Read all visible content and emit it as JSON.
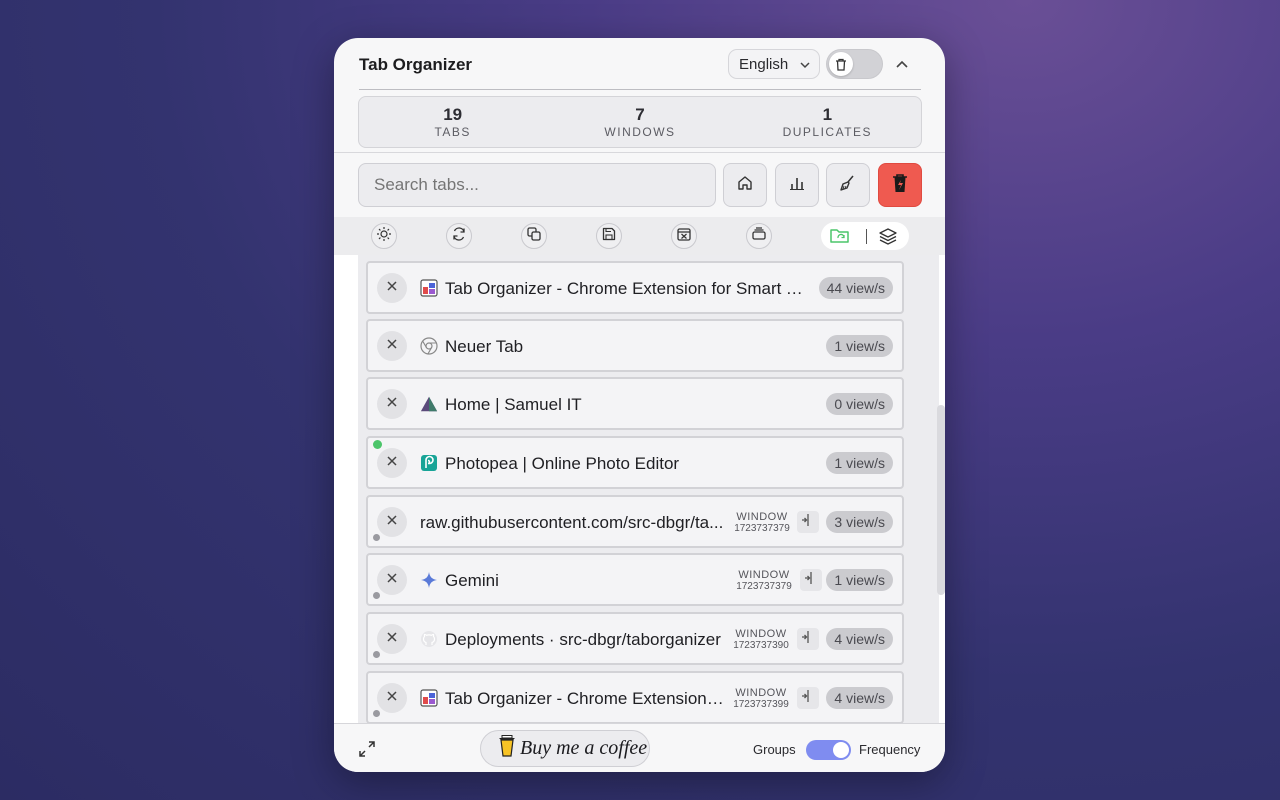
{
  "header": {
    "title": "Tab Organizer",
    "language": "English",
    "icons": [
      "chevron-down-icon",
      "trash-icon",
      "chevron-up-icon"
    ]
  },
  "stats": [
    {
      "value": "19",
      "label": "TABS"
    },
    {
      "value": "7",
      "label": "WINDOWS"
    },
    {
      "value": "1",
      "label": "DUPLICATES"
    }
  ],
  "search": {
    "placeholder": "Search tabs..."
  },
  "toolbar": {
    "buttons": [
      "home-icon",
      "bar-chart-icon",
      "broom-icon",
      "trash-lightning-icon"
    ],
    "danger_color": "#ef5a50"
  },
  "iconbar": {
    "buttons": [
      "sun-icon",
      "refresh-icon",
      "duplicate-icon",
      "save-icon",
      "close-folder-icon",
      "archive-icon"
    ],
    "group_switch": [
      "folder-sync-icon",
      "layers-icon"
    ],
    "accent_color": "#4cc56a"
  },
  "tabs": [
    {
      "title": "Tab Organizer - Chrome Extension for Smart Ta...",
      "views": "44 view/s",
      "favicon": "tab-organizer-icon"
    },
    {
      "title": "Neuer Tab",
      "views": "1 view/s",
      "favicon": "chrome-icon"
    },
    {
      "title": "Home | Samuel IT",
      "views": "0 view/s",
      "favicon": "triangle-logo-icon"
    },
    {
      "title": "Photopea | Online Photo Editor",
      "views": "1 view/s",
      "favicon": "photopea-icon",
      "active": true
    },
    {
      "title": "raw.githubusercontent.com/src-dbgr/ta...",
      "views": "3 view/s",
      "window_label": "WINDOW",
      "window_id": "1723737379"
    },
    {
      "title": "Gemini",
      "views": "1 view/s",
      "favicon": "sparkle-icon",
      "window_label": "WINDOW",
      "window_id": "1723737379"
    },
    {
      "title": "Deployments · src-dbgr/taborganizer",
      "views": "4 view/s",
      "favicon": "github-icon",
      "window_label": "WINDOW",
      "window_id": "1723737390"
    },
    {
      "title": "Tab Organizer - Chrome Extension f...",
      "views": "4 view/s",
      "favicon": "tab-organizer-icon",
      "window_label": "WINDOW",
      "window_id": "1723737399"
    }
  ],
  "footer": {
    "coffee_label": "Buy me a coffee",
    "left_label": "Groups",
    "right_label": "Frequency",
    "toggle_color": "#7f8cf0"
  }
}
